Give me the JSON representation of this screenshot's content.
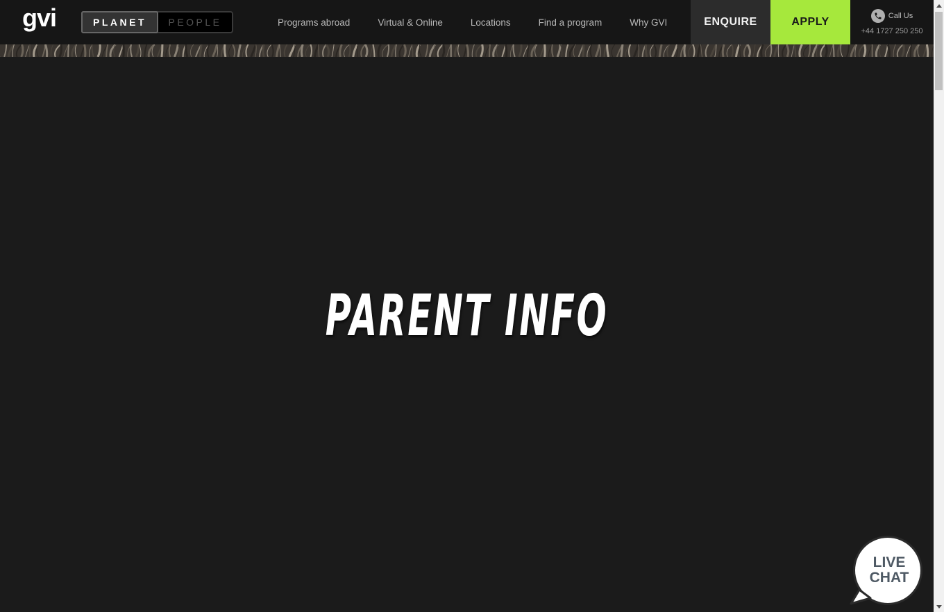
{
  "header": {
    "logo_text": "gvi",
    "toggle": {
      "active": "PLANET",
      "inactive": "PEOPLE"
    },
    "nav": [
      "Programs abroad",
      "Virtual & Online",
      "Locations",
      "Find a program",
      "Why GVI"
    ],
    "enquire_label": "ENQUIRE",
    "apply_label": "APPLY",
    "call": {
      "label": "Call Us",
      "number": "+44 1727 250 250",
      "icon": "phone-icon"
    }
  },
  "hero": {
    "title": "PARENT INFO"
  },
  "live_chat": {
    "line1": "LIVE",
    "line2": "CHAT"
  },
  "colors": {
    "accent": "#a6e83c",
    "background": "#1b1b1b",
    "header": "#161616"
  }
}
